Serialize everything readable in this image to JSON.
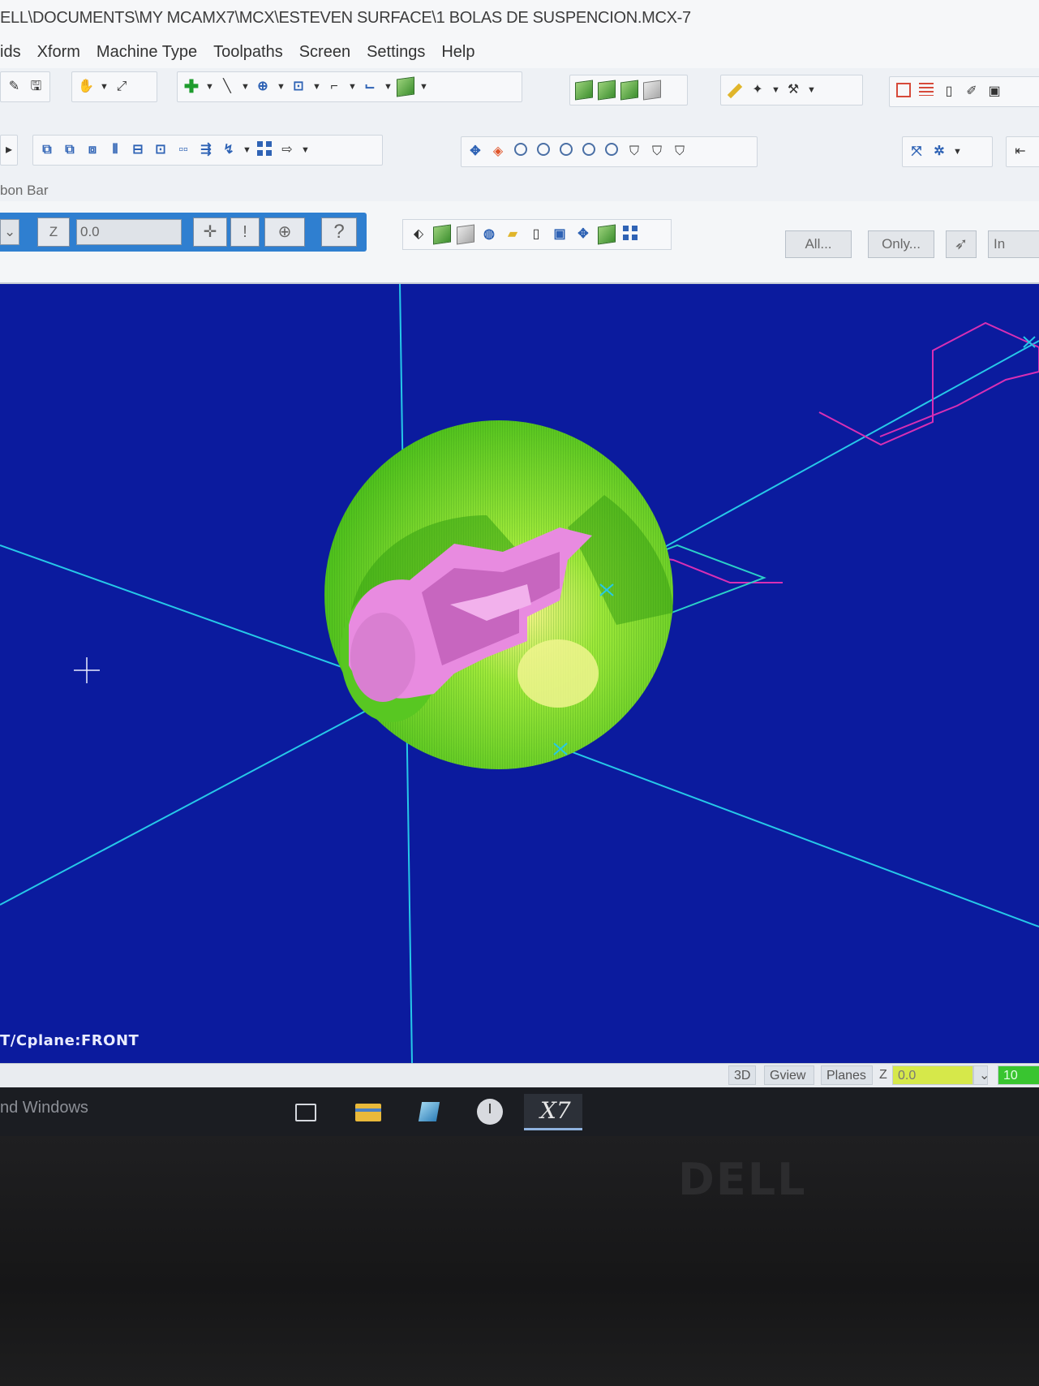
{
  "window": {
    "title": "ELL\\DOCUMENTS\\MY MCAMX7\\MCX\\ESTEVEN SURFACE\\1 BOLAS DE SUSPENCION.MCX-7"
  },
  "menu": {
    "items": [
      "ids",
      "Xform",
      "Machine Type",
      "Toolpaths",
      "Screen",
      "Settings",
      "Help"
    ]
  },
  "ribbon_bar": {
    "label": "bon Bar",
    "z_label": "Z",
    "z_value": "0.0",
    "help_symbol": "?",
    "all_button": "All...",
    "only_button": "Only...",
    "in_field": "In"
  },
  "viewport": {
    "background_color": "#0b1b9e",
    "cplane_text": "T/Cplane:FRONT",
    "model_colors": {
      "sphere": "#6fd62a",
      "insert": "#e88be0",
      "axes": "#26c8e8",
      "wireframe": "#d82fb4"
    }
  },
  "status_bar": {
    "view_3d": "3D",
    "gview": "Gview",
    "planes": "Planes",
    "z_label": "Z",
    "z_value": "0.0",
    "level": "10"
  },
  "taskbar": {
    "activate_text": "nd Windows",
    "active_app_label": "X7"
  },
  "bezel": {
    "brand": "DELL"
  }
}
